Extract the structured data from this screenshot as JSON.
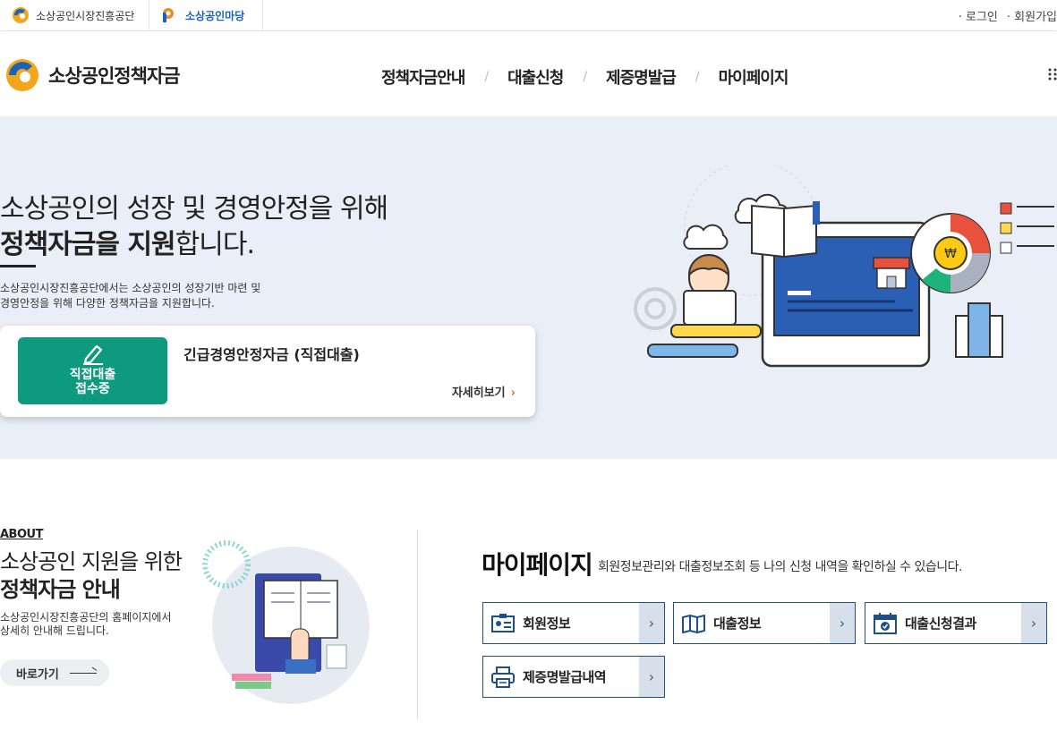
{
  "topbar": {
    "family1": "소상공인시장진흥공단",
    "family2": "소상공인마당",
    "login": "· 로그인",
    "join": "· 회원가입"
  },
  "header": {
    "logo_text": "소상공인정책자금",
    "nav": [
      "정책자금안내",
      "대출신청",
      "제증명발급",
      "마이페이지"
    ],
    "nav_sep": "/",
    "allmenu_icon": "grid-menu-icon"
  },
  "hero": {
    "headline_line1": "소상공인의 성장 및 경영안정을 위해",
    "headline_bold": "정책자금을 지원",
    "headline_rest": "합니다.",
    "desc_line1": "소상공인시장진흥공단에서는 소상공인의 성장기반 마련 및",
    "desc_line2": "경영안정을 위해 다양한 정책자금을 지원합니다.",
    "card": {
      "badge_line1": "직접대출",
      "badge_line2": "접수중",
      "title": "긴급경영안정자금 (직접대출)",
      "more": "자세히보기",
      "accent": "#0e9a7f"
    }
  },
  "about": {
    "label": "ABOUT",
    "heading_line1": "소상공인 지원을 위한",
    "heading_bold": "정책자금 안내",
    "desc_line1": "소상공인시장진흥공단의 홈페이지에서",
    "desc_line2": "상세히 안내해 드립니다.",
    "button": "바로가기"
  },
  "mypage": {
    "title": "마이페이지",
    "desc": "회원정보관리와 대출정보조회 등 나의 신청 내역을 확인하실 수 있습니다.",
    "buttons": [
      {
        "label": "회원정보",
        "icon": "id-card-icon"
      },
      {
        "label": "대출정보",
        "icon": "map-book-icon"
      },
      {
        "label": "대출신청결과",
        "icon": "calendar-check-icon"
      },
      {
        "label": "제증명발급내역",
        "icon": "printer-icon"
      }
    ]
  }
}
